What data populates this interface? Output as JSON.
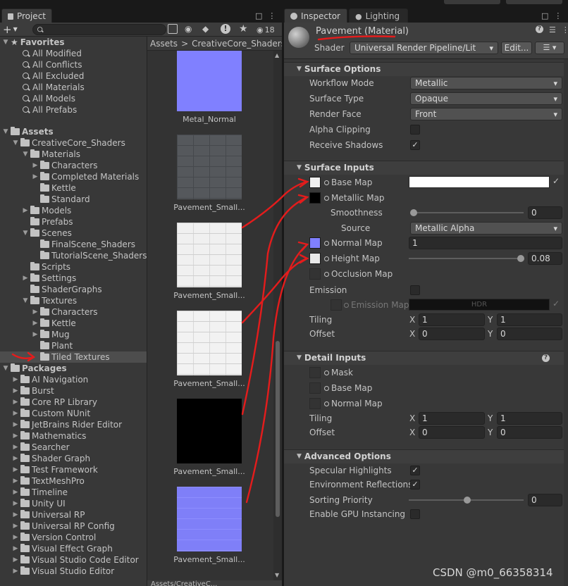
{
  "project_tab": {
    "label": "Project"
  },
  "toolbar": {
    "hidden_count": "18"
  },
  "favorites": {
    "title": "Favorites",
    "items": [
      "All Modified",
      "All Conflicts",
      "All Excluded",
      "All Materials",
      "All Models",
      "All Prefabs"
    ]
  },
  "assets": {
    "title": "Assets",
    "tree": [
      {
        "label": "CreativeCore_Shaders",
        "depth": 1,
        "open": true
      },
      {
        "label": "Materials",
        "depth": 2,
        "open": true
      },
      {
        "label": "Characters",
        "depth": 3,
        "open": false
      },
      {
        "label": "Completed Materials",
        "depth": 3,
        "open": false
      },
      {
        "label": "Kettle",
        "depth": 3,
        "leaf": true
      },
      {
        "label": "Standard",
        "depth": 3,
        "leaf": true
      },
      {
        "label": "Models",
        "depth": 2,
        "open": false
      },
      {
        "label": "Prefabs",
        "depth": 2,
        "leaf": true
      },
      {
        "label": "Scenes",
        "depth": 2,
        "open": true
      },
      {
        "label": "FinalScene_Shaders",
        "depth": 3,
        "leaf": true
      },
      {
        "label": "TutorialScene_Shaders",
        "depth": 3,
        "leaf": true
      },
      {
        "label": "Scripts",
        "depth": 2,
        "leaf": true
      },
      {
        "label": "Settings",
        "depth": 2,
        "open": false
      },
      {
        "label": "ShaderGraphs",
        "depth": 2,
        "leaf": true
      },
      {
        "label": "Textures",
        "depth": 2,
        "open": true
      },
      {
        "label": "Characters",
        "depth": 3,
        "open": false
      },
      {
        "label": "Kettle",
        "depth": 3,
        "open": false
      },
      {
        "label": "Mug",
        "depth": 3,
        "open": false
      },
      {
        "label": "Plant",
        "depth": 3,
        "leaf": true
      },
      {
        "label": "Tiled Textures",
        "depth": 3,
        "leaf": true,
        "selected": true
      }
    ]
  },
  "packages": {
    "title": "Packages",
    "items": [
      "AI Navigation",
      "Burst",
      "Core RP Library",
      "Custom NUnit",
      "JetBrains Rider Editor",
      "Mathematics",
      "Searcher",
      "Shader Graph",
      "Test Framework",
      "TextMeshPro",
      "Timeline",
      "Unity UI",
      "Universal RP",
      "Universal RP Config",
      "Version Control",
      "Visual Effect Graph",
      "Visual Studio Code Editor",
      "Visual Studio Editor"
    ]
  },
  "breadcrumb": {
    "root": "Assets",
    "sep": ">",
    "current": "CreativeCore_Shaders"
  },
  "grid_items": [
    {
      "caption": "Metal_Normal",
      "color": "#8080ff"
    },
    {
      "caption": "Pavement_Small...",
      "color": "#55585c"
    },
    {
      "caption": "Pavement_Small...",
      "color": "#f0f0f0"
    },
    {
      "caption": "Pavement_Small...",
      "color": "#f2f2f2"
    },
    {
      "caption": "Pavement_Small...",
      "color": "#000000"
    },
    {
      "caption": "Pavement_Small...",
      "color": "#7f7ff8"
    }
  ],
  "bottom_path": "Assets/CreativeC...",
  "inspector_tab": {
    "label": "Inspector"
  },
  "lighting_tab": {
    "label": "Lighting"
  },
  "material": {
    "name": "Pavement (Material)",
    "shader_label": "Shader",
    "shader_value": "Universal Render Pipeline/Lit",
    "edit_label": "Edit..."
  },
  "surface_options": {
    "title": "Surface Options",
    "workflow_mode": {
      "label": "Workflow Mode",
      "value": "Metallic"
    },
    "surface_type": {
      "label": "Surface Type",
      "value": "Opaque"
    },
    "render_face": {
      "label": "Render Face",
      "value": "Front"
    },
    "alpha_clipping": {
      "label": "Alpha Clipping",
      "checked": false
    },
    "receive_shadows": {
      "label": "Receive Shadows",
      "checked": true
    }
  },
  "surface_inputs": {
    "title": "Surface Inputs",
    "base_map": {
      "label": "Base Map",
      "swatch": "#f0f0f0",
      "color": "#ffffff"
    },
    "metallic_map": {
      "label": "Metallic Map",
      "swatch": "#000000"
    },
    "smoothness": {
      "label": "Smoothness",
      "value": "0",
      "fraction": 0
    },
    "source": {
      "label": "Source",
      "value": "Metallic Alpha"
    },
    "normal_map": {
      "label": "Normal Map",
      "swatch": "#8080ff",
      "value": "1"
    },
    "height_map": {
      "label": "Height Map",
      "swatch": "#e8e8e8",
      "value": "0.08",
      "fraction": 1
    },
    "occlusion_map": {
      "label": "Occlusion Map"
    },
    "emission": {
      "label": "Emission",
      "checked": false
    },
    "emission_map": {
      "label": "Emission Map",
      "hdr": "HDR"
    },
    "tiling": {
      "label": "Tiling",
      "x": "1",
      "y": "1"
    },
    "offset": {
      "label": "Offset",
      "x": "0",
      "y": "0"
    }
  },
  "detail_inputs": {
    "title": "Detail Inputs",
    "mask": {
      "label": "Mask"
    },
    "base_map": {
      "label": "Base Map"
    },
    "normal_map": {
      "label": "Normal Map"
    },
    "tiling": {
      "label": "Tiling",
      "x": "1",
      "y": "1"
    },
    "offset": {
      "label": "Offset",
      "x": "0",
      "y": "0"
    }
  },
  "advanced_options": {
    "title": "Advanced Options",
    "specular_highlights": {
      "label": "Specular Highlights",
      "checked": true
    },
    "environment_reflections": {
      "label": "Environment Reflections",
      "checked": true
    },
    "sorting_priority": {
      "label": "Sorting Priority",
      "value": "0",
      "fraction": 0.5
    },
    "gpu_instancing": {
      "label": "Enable GPU Instancing",
      "checked": false
    }
  },
  "axis": {
    "x": "X",
    "y": "Y"
  },
  "watermark": "CSDN @m0_66358314"
}
